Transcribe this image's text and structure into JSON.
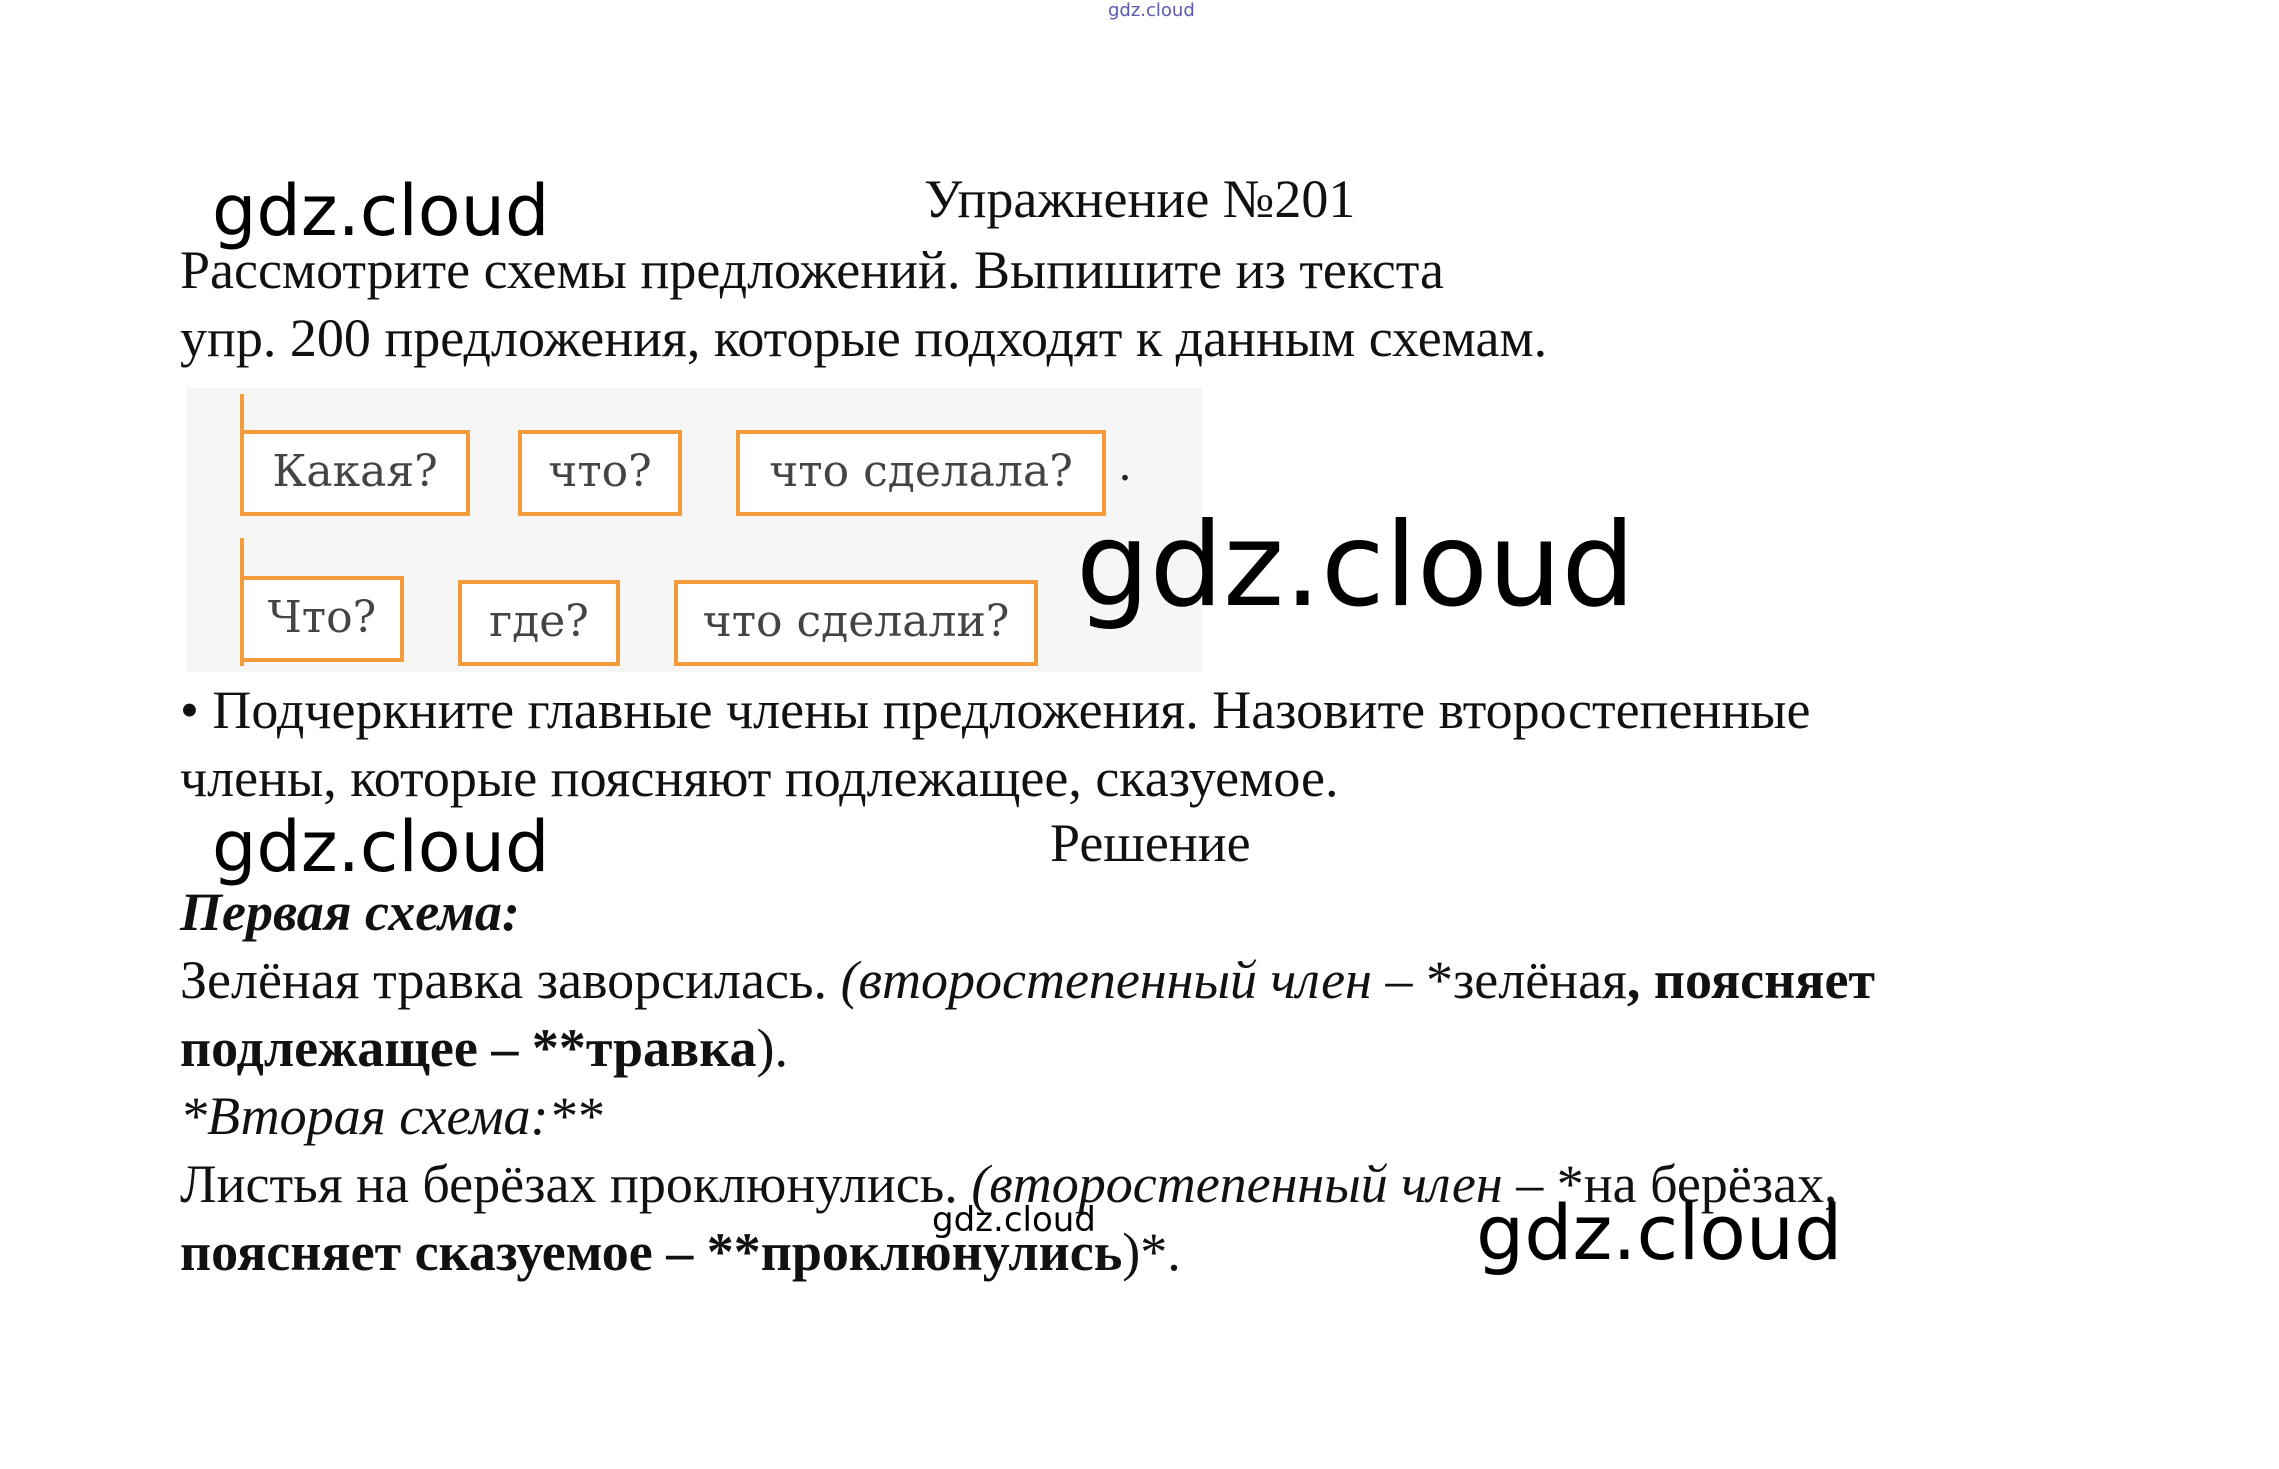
{
  "watermarks": {
    "top_small": "gdz.cloud",
    "wm1": "gdz.cloud",
    "wm2": "gdz.cloud",
    "wm3": "gdz.cloud",
    "wm4": "gdz.cloud",
    "wm5": "gdz.cloud"
  },
  "exercise": {
    "title": "Упражнение №201",
    "task_line1": "Рассмотрите схемы предложений. Выпишите из текста",
    "task_line2": "упр. 200 предложения, которые подходят к данным схемам.",
    "scheme1": [
      "Какая?",
      "что?",
      "что сделала?"
    ],
    "scheme2": [
      "Что?",
      "где?",
      "что сделали?"
    ],
    "scheme_end": ".",
    "bullet_line1": "• Подчеркните главные члены предложения. Назовите второстепенные",
    "bullet_line2": "члены, которые поясняют подлежащее, сказуемое."
  },
  "solution": {
    "heading": "Решение",
    "first_title": "Первая схема:",
    "first_plain": "Зелёная травка заворсилась. ",
    "first_italic": "(второстепенный член – ",
    "first_word": "*зелёная",
    "first_bold1": ", поясняет",
    "first_bold2": "подлежащее – **травка",
    "first_end": ").",
    "second_title": "*Вторая схема:**",
    "second_plain": "Листья на берёзах проклюнулись. ",
    "second_italic": "(второстепенный член – ",
    "second_word": "*на берёзах,",
    "second_bold": "поясняет сказуемое – **проклюнулись",
    "second_end": ")*."
  }
}
